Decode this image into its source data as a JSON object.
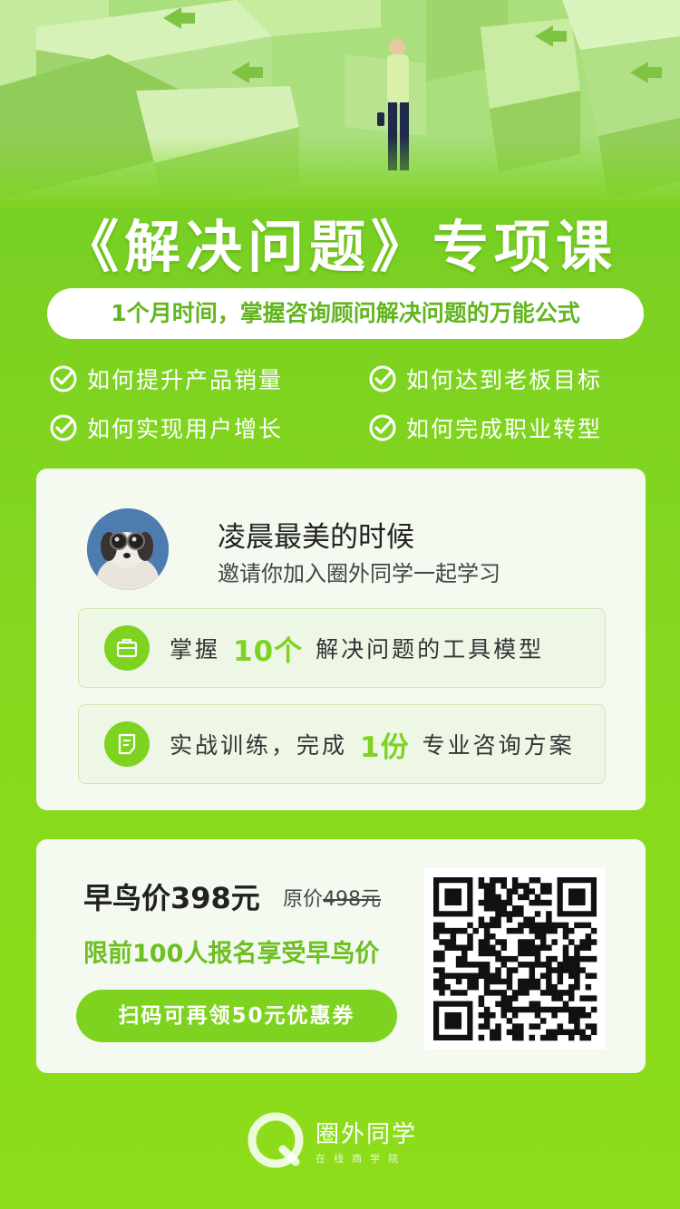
{
  "hero": {
    "title": "《解决问题》专项课",
    "subtitle": "1个月时间，掌握咨询顾问解决问题的万能公式"
  },
  "features": [
    {
      "label": "如何提升产品销量",
      "icon": "check-circle-icon"
    },
    {
      "label": "如何达到老板目标",
      "icon": "check-circle-icon"
    },
    {
      "label": "如何实现用户增长",
      "icon": "check-circle-icon"
    },
    {
      "label": "如何完成职业转型",
      "icon": "check-circle-icon"
    }
  ],
  "invite": {
    "user_name": "凌晨最美的时候",
    "message": "邀请你加入圈外同学一起学习"
  },
  "benefits": [
    {
      "prefix": "掌握",
      "highlight": "10个",
      "suffix": "解决问题的工具模型",
      "icon": "briefcase-icon"
    },
    {
      "prefix": "实战训练，完成",
      "highlight": "1份",
      "suffix": "专业咨询方案",
      "icon": "document-icon"
    }
  ],
  "pricing": {
    "early_label": "早鸟价398元",
    "original_prefix": "原价",
    "original_price": "498元",
    "limit_text": "限前100人报名享受早鸟价",
    "coupon_button": "扫码可再领50元优惠券"
  },
  "footer": {
    "brand_name": "圈外同学",
    "tagline": "在线商学院"
  },
  "colors": {
    "accent": "#7ed321",
    "card_bg": "#f4faf0"
  }
}
